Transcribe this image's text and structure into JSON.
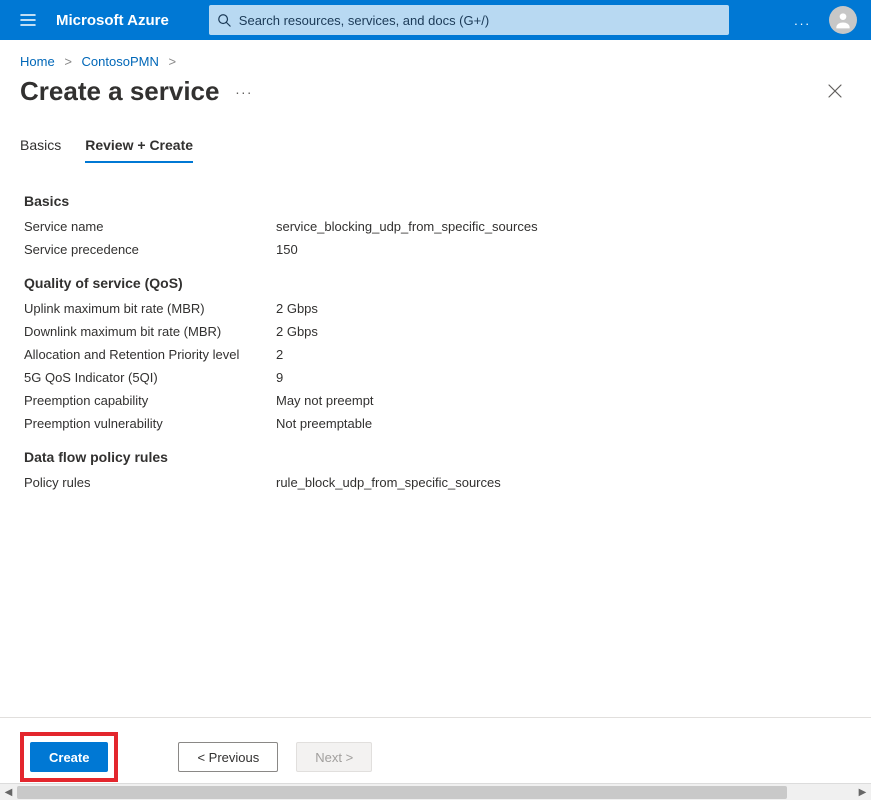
{
  "header": {
    "brand": "Microsoft Azure",
    "search_placeholder": "Search resources, services, and docs (G+/)",
    "more": "..."
  },
  "breadcrumb": {
    "items": [
      "Home",
      "ContosoPMN"
    ],
    "separator": ">"
  },
  "page": {
    "title": "Create a service",
    "more": "..."
  },
  "tabs": [
    {
      "label": "Basics",
      "active": false
    },
    {
      "label": "Review + Create",
      "active": true
    }
  ],
  "sections": {
    "basics": {
      "heading": "Basics",
      "rows": [
        {
          "k": "Service name",
          "v": "service_blocking_udp_from_specific_sources"
        },
        {
          "k": "Service precedence",
          "v": "150"
        }
      ]
    },
    "qos": {
      "heading": "Quality of service (QoS)",
      "rows": [
        {
          "k": "Uplink maximum bit rate (MBR)",
          "v": "2 Gbps"
        },
        {
          "k": "Downlink maximum bit rate (MBR)",
          "v": "2 Gbps"
        },
        {
          "k": "Allocation and Retention Priority level",
          "v": "2"
        },
        {
          "k": "5G QoS Indicator (5QI)",
          "v": "9"
        },
        {
          "k": "Preemption capability",
          "v": "May not preempt"
        },
        {
          "k": "Preemption vulnerability",
          "v": "Not preemptable"
        }
      ]
    },
    "rules": {
      "heading": "Data flow policy rules",
      "rows": [
        {
          "k": "Policy rules",
          "v": "rule_block_udp_from_specific_sources"
        }
      ]
    }
  },
  "footer": {
    "create": "Create",
    "previous": "< Previous",
    "next": "Next >"
  }
}
